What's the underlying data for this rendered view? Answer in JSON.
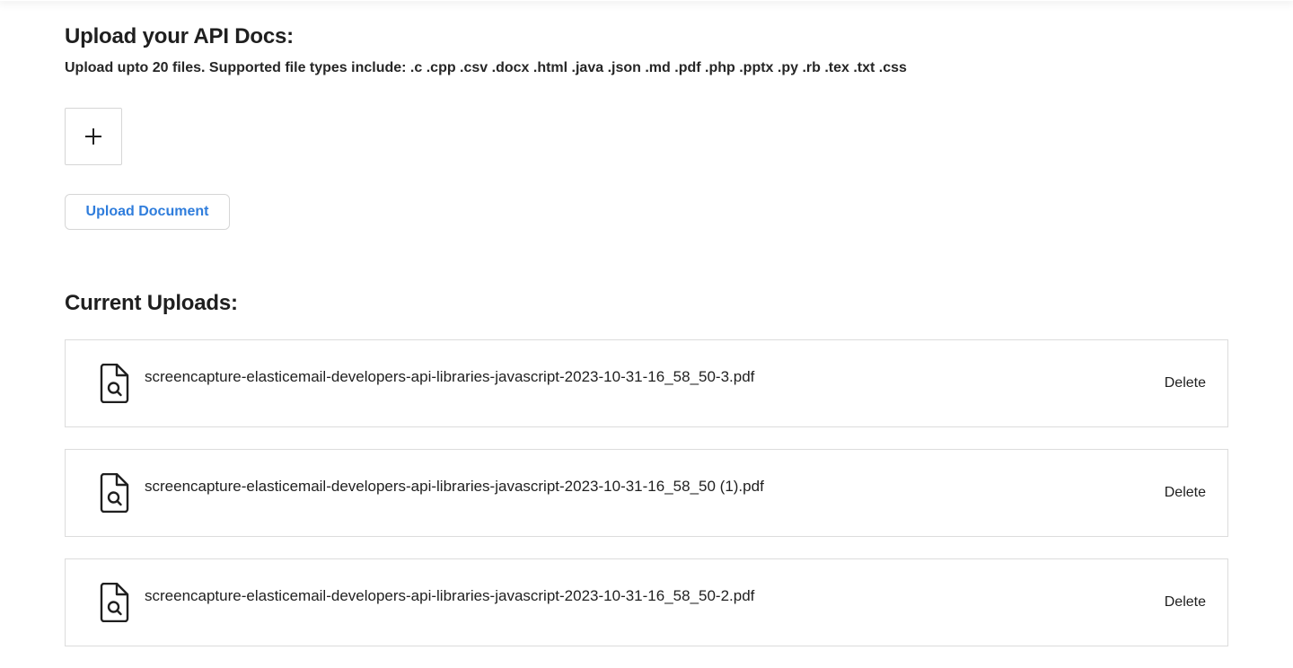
{
  "upload_section": {
    "title": "Upload your API Docs:",
    "subtitle": "Upload upto 20 files. Supported file types include: .c .cpp .csv .docx .html .java .json .md .pdf .php .pptx .py .rb .tex .txt .css",
    "add_icon": "plus-icon",
    "upload_button_label": "Upload Document"
  },
  "current_uploads": {
    "title": "Current Uploads:",
    "file_icon": "file-search-icon",
    "items": [
      {
        "name": "screencapture-elasticemail-developers-api-libraries-javascript-2023-10-31-16_58_50-3.pdf",
        "action": "Delete"
      },
      {
        "name": "screencapture-elasticemail-developers-api-libraries-javascript-2023-10-31-16_58_50 (1).pdf",
        "action": "Delete"
      },
      {
        "name": "screencapture-elasticemail-developers-api-libraries-javascript-2023-10-31-16_58_50-2.pdf",
        "action": "Delete"
      }
    ]
  },
  "colors": {
    "accent": "#2f7ddc",
    "border": "#dcdcdc",
    "text": "#1f1f1f"
  }
}
